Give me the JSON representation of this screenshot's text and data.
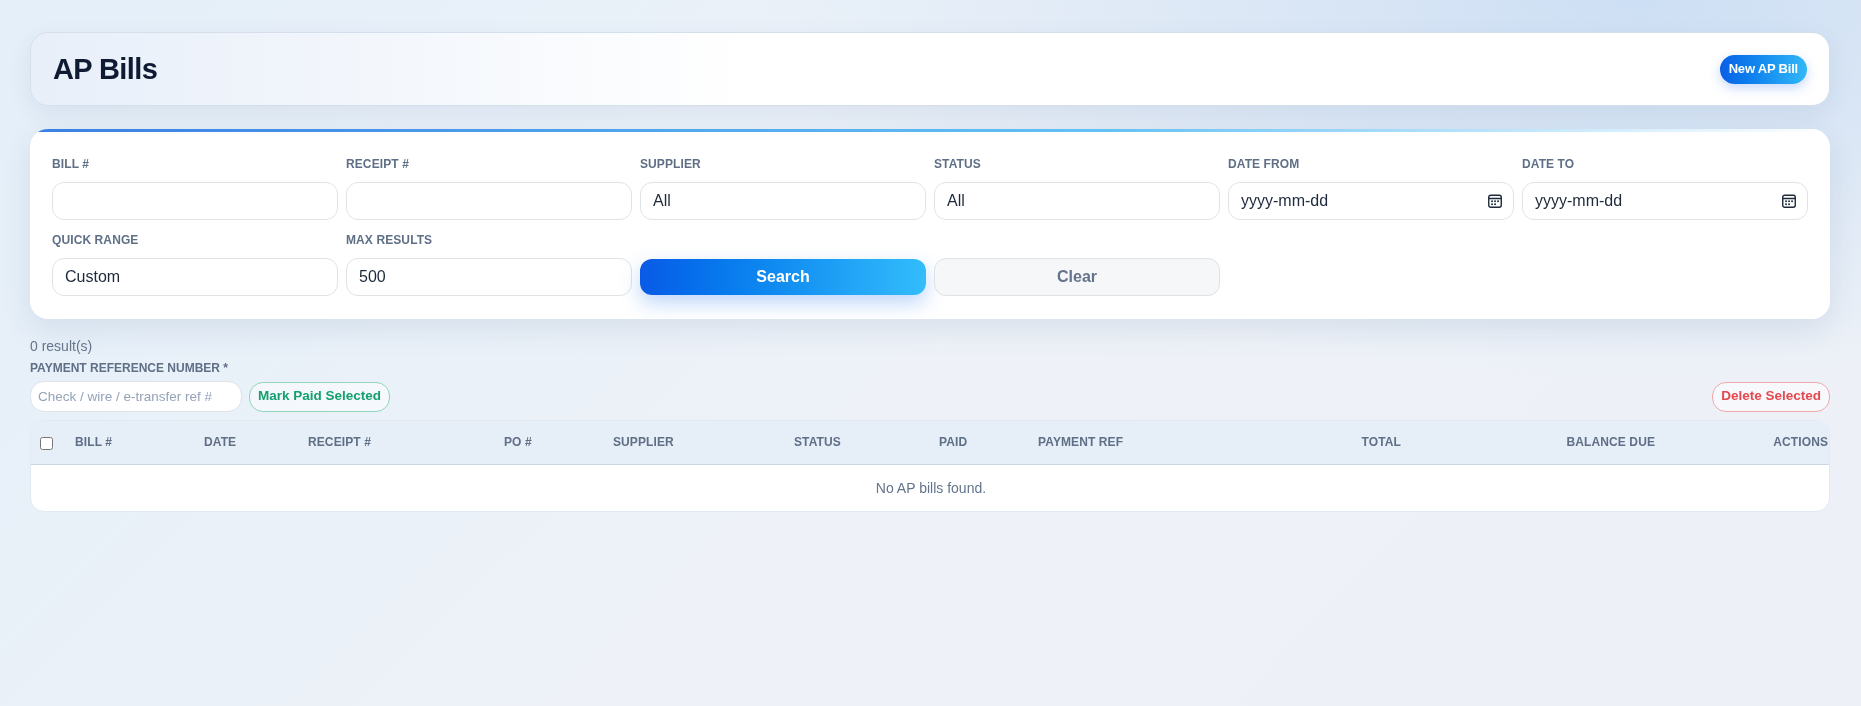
{
  "header": {
    "title": "AP Bills",
    "new_button": "New AP Bill"
  },
  "filters": {
    "fields": [
      {
        "label": "BILL #",
        "kind": "text"
      },
      {
        "label": "RECEIPT #",
        "kind": "text"
      },
      {
        "label": "SUPPLIER",
        "kind": "select",
        "value": "All"
      },
      {
        "label": "STATUS",
        "kind": "select",
        "value": "All"
      },
      {
        "label": "DATE FROM",
        "kind": "date",
        "placeholder": "yyyy-mm-dd"
      },
      {
        "label": "DATE TO",
        "kind": "date",
        "placeholder": "yyyy-mm-dd"
      },
      {
        "label": "QUICK RANGE",
        "kind": "select",
        "value": "Custom"
      },
      {
        "label": "MAX RESULTS",
        "kind": "text",
        "value": "500"
      }
    ],
    "buttons": [
      {
        "label": "Search",
        "kind": "primary"
      },
      {
        "label": "Clear",
        "kind": "secondary"
      }
    ]
  },
  "results": {
    "count": "0 result(s)"
  },
  "payment": {
    "label": "PAYMENT REFERENCE NUMBER *",
    "placeholder": "Check / wire / e-transfer ref #"
  },
  "bulk_actions": [
    {
      "label": "Mark Paid Selected",
      "kind": "success"
    },
    {
      "label": "Delete Selected",
      "kind": "danger"
    }
  ],
  "table": {
    "select_all": {
      "checked": false
    },
    "columns": [
      "BILL #",
      "DATE",
      "RECEIPT #",
      "PO #",
      "SUPPLIER",
      "STATUS",
      "PAID",
      "PAYMENT REF",
      "TOTAL",
      "BALANCE DUE",
      "ACTIONS"
    ],
    "empty_message": "No AP bills found."
  }
}
